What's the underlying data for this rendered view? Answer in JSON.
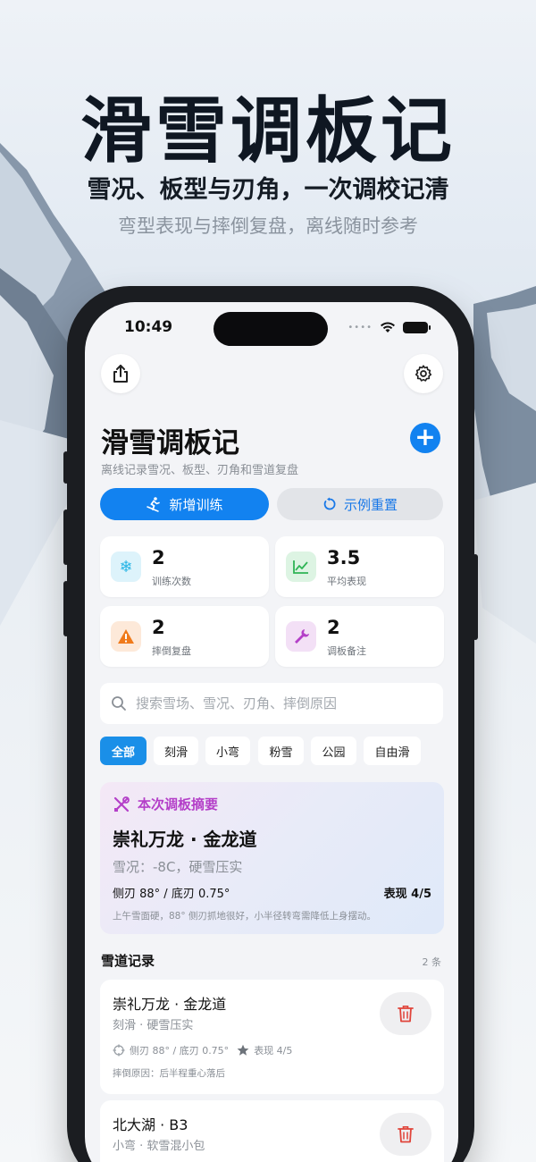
{
  "promo": {
    "headline": "滑雪调板记",
    "subline": "雪况、板型与刃角，一次调校记清",
    "tagline": "弯型表现与摔倒复盘，离线随时参考"
  },
  "status_bar": {
    "time": "10:49",
    "dots": "••••"
  },
  "header": {
    "share_icon": "share-icon",
    "settings_icon": "gear-icon",
    "title": "滑雪调板记",
    "subtitle": "离线记录雪况、板型、刃角和雪道复盘",
    "add_label": "+"
  },
  "actions": {
    "new_training": "新增训练",
    "reset_example": "示例重置"
  },
  "stats": [
    {
      "value": "2",
      "label": "训练次数",
      "icon": "snowflake-icon",
      "color": "#2bb6e6",
      "bg": "#ddf3fb",
      "glyph": "❄"
    },
    {
      "value": "3.5",
      "label": "平均表现",
      "icon": "trend-chart-icon",
      "color": "#2fb455",
      "bg": "#ddf4e3",
      "glyph": "↗"
    },
    {
      "value": "2",
      "label": "摔倒复盘",
      "icon": "warning-icon",
      "color": "#f07a1a",
      "bg": "#fde9d9",
      "glyph": "⚠"
    },
    {
      "value": "2",
      "label": "调板备注",
      "icon": "wrench-icon",
      "color": "#b43fc8",
      "bg": "#f3e0f6",
      "glyph": "✎"
    }
  ],
  "search": {
    "placeholder": "搜索雪场、雪况、刃角、摔倒原因",
    "value": ""
  },
  "filters": [
    "全部",
    "刻滑",
    "小弯",
    "粉雪",
    "公园",
    "自由滑"
  ],
  "summary": {
    "heading": "本次调板摘要",
    "title": "崇礼万龙 · 金龙道",
    "condition": "雪况：-8C，硬雪压实",
    "edge": "侧刃 88° / 底刃 0.75°",
    "score": "表现 4/5",
    "note": "上午雪面硬，88° 侧刃抓地很好，小半径转弯需降低上身摆动。"
  },
  "records_section": {
    "title": "雪道记录",
    "count": "2 条"
  },
  "records": [
    {
      "title": "崇礼万龙 · 金龙道",
      "subtitle": "刻滑 · 硬雪压实",
      "edge": "侧刃 88° / 底刃 0.75°",
      "score": "表现 4/5",
      "fall": "摔倒原因：后半程重心落后"
    },
    {
      "title": "北大湖 · B3",
      "subtitle": "小弯 · 软雪混小包"
    }
  ],
  "colors": {
    "accent": "#1282f0",
    "summary_accent": "#b43fc8",
    "delete": "#e0443a"
  }
}
